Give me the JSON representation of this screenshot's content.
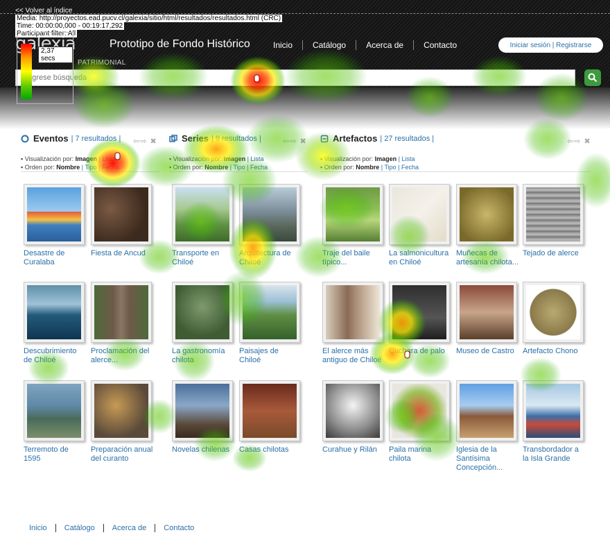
{
  "tracking": {
    "back_link": "<< Volver al índice",
    "media": "Media: http://proyectos.ead.pucv.cl/galexia/sitio/html/resultados/resultados.html (CRC)",
    "time": "Time: 00:00:00,000 - 00:19:17,292",
    "participant": "Participant filter: All",
    "legend_value": "2,37 secs",
    "legend_colors": [
      "#ff0000",
      "#ff9900",
      "#ffff00",
      "#66cc00",
      "#00aa00"
    ]
  },
  "header": {
    "logo": "galexia",
    "title": "Prototipo de Fondo Histórico",
    "subtitle": "PATRIMONIAL",
    "nav": [
      "Inicio",
      "Catálogo",
      "Acerca de",
      "Contacto"
    ],
    "login": "Iniciar sesión | Registrarse",
    "search_placeholder": "Ingrese búsqueda",
    "search_icon": "search-icon"
  },
  "columns": [
    {
      "title": "Eventos",
      "count": "| 7 resultados |",
      "icon": "eventos-icon",
      "nav": "⇦⇨ ✖",
      "view_label": "▪ Visualización por:",
      "view_active": "Imagen",
      "view_other": "| Lista",
      "sort_label": "▪ Orden por:",
      "sort_active": "Nombre",
      "sort_other": "| Tipo | Fecha"
    },
    {
      "title": "Series",
      "count": "| 9 resultados |",
      "icon": "series-icon",
      "nav": "⇦⇨ ✖",
      "view_label": "▪ Visualización por:",
      "view_active": "Imagen",
      "view_other": "| Lista",
      "sort_label": "▪ Orden por:",
      "sort_active": "Nombre",
      "sort_other": "| Tipo | Fecha"
    },
    {
      "title": "Artefactos",
      "count": "| 27 resultados |",
      "icon": "artefactos-icon",
      "nav": "⇦⇨ ✖",
      "view_label": "▪ Visualización por:",
      "view_active": "Imagen",
      "view_other": "| Lista",
      "sort_label": "▪ Orden por:",
      "sort_active": "Nombre",
      "sort_other": "| Tipo | Fecha"
    }
  ],
  "items": [
    {
      "caption": "Desastre de Curalaba",
      "pic": "p-village"
    },
    {
      "caption": "Fiesta de Ancud",
      "pic": "p-crowd"
    },
    {
      "caption": "Transporte en Chiloé",
      "pic": "p-road"
    },
    {
      "caption": "Arquitectura de Chiloé",
      "pic": "p-stilts"
    },
    {
      "caption": "Traje del baile típico...",
      "pic": "p-dance"
    },
    {
      "caption": "La salmonicultura en Chiloé",
      "pic": "p-map"
    },
    {
      "caption": "Muñecas de artesanía chilota...",
      "pic": "p-dolls"
    },
    {
      "caption": "Tejado de alerce",
      "pic": "p-shingle"
    },
    {
      "caption": "Descubrimiento de Chiloé",
      "pic": "p-coast"
    },
    {
      "caption": "Proclamación del alerce...",
      "pic": "p-tree"
    },
    {
      "caption": "La gastronomía chilota",
      "pic": "p-curanto1"
    },
    {
      "caption": "Paisajes de Chiloé",
      "pic": "p-land"
    },
    {
      "caption": "El alerce más antiguo de Chiloé",
      "pic": "p-alerce"
    },
    {
      "caption": "Cuchara de palo",
      "pic": "p-dark"
    },
    {
      "caption": "Museo de Castro",
      "pic": "p-room"
    },
    {
      "caption": "Artefacto Chono",
      "pic": "p-yarn"
    },
    {
      "caption": "Terremoto de 1595",
      "pic": "p-aerial"
    },
    {
      "caption": "Preparación anual del curanto",
      "pic": "p-oysters"
    },
    {
      "caption": "Novelas chilenas",
      "pic": "p-bedroom"
    },
    {
      "caption": "Casas chilotas",
      "pic": "p-house"
    },
    {
      "caption": "Curahue y Rilán",
      "pic": "p-portrait"
    },
    {
      "caption": "Paila marina chilota",
      "pic": "p-soup"
    },
    {
      "caption": "Iglesia de la Santísima Concepción...",
      "pic": "p-church"
    },
    {
      "caption": "Transbordador a la Isla Grande",
      "pic": "p-ferry"
    }
  ],
  "footer": [
    "Inicio",
    "Catálogo",
    "Acerca de",
    "Contacto"
  ]
}
